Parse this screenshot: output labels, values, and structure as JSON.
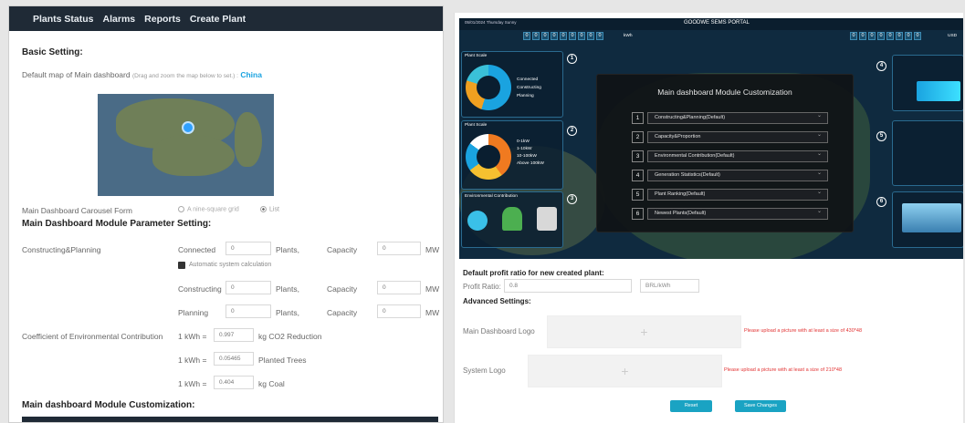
{
  "nav": {
    "items": [
      "Plants Status",
      "Alarms",
      "Reports",
      "Create Plant"
    ]
  },
  "left": {
    "basic_setting": "Basic Setting:",
    "default_map": "Default map of Main dashboard",
    "default_map_hint": "(Drag and zoom the map below to set.) :",
    "default_map_value": "China",
    "carousel_label": "Main Dashboard Carousel Form",
    "carousel_opt1": "A nine-square grid",
    "carousel_opt2": "List",
    "module_param": "Main Dashboard Module Parameter Setting:",
    "constructing_planning": "Constructing&Planning",
    "connected": "Connected",
    "constructing": "Constructing",
    "planning": "Planning",
    "plants": "Plants,",
    "capacity": "Capacity",
    "mw": "MW",
    "zero": "0",
    "auto_calc": "Automatic system calculation",
    "coef_label": "Coefficient of Environmental Contribution",
    "kwh": "1 kWh =",
    "co2_value": "0.997",
    "co2_unit": "kg CO2 Reduction",
    "trees_value": "0.05465",
    "trees_unit": "Planted Trees",
    "coal_value": "0.404",
    "coal_unit": "kg Coal",
    "module_custom": "Main dashboard Module Customization:"
  },
  "dashboard": {
    "date": "05/01/2024   Thursday   Sunny",
    "portal": "GOODWE SEMS PORTAL",
    "usd": "USD",
    "kwh": "kWh",
    "plant_scale_1": "Plant Scale",
    "plant_scale_2": "Plant Scale",
    "env_contribution": "Environmental Contribution",
    "badges": [
      "1",
      "2",
      "3",
      "4",
      "5",
      "6"
    ],
    "modal": {
      "title": "Main dashboard Module Customization",
      "rows": [
        {
          "n": "1",
          "label": "Constructing&Planning(Default)"
        },
        {
          "n": "2",
          "label": "Capacity&Proportion"
        },
        {
          "n": "3",
          "label": "Environmental Contribution(Default)"
        },
        {
          "n": "4",
          "label": "Generation Statistics(Default)"
        },
        {
          "n": "5",
          "label": "Plant Ranking(Default)"
        },
        {
          "n": "6",
          "label": "Newest Plants(Default)"
        }
      ]
    },
    "legend1": [
      "Connected",
      "Constructing",
      "Planning"
    ],
    "legend2": [
      "0-1kW",
      "1-10kW",
      "10-100kW",
      "Above 100kW"
    ]
  },
  "right": {
    "profit_heading": "Default profit ratio for new created plant:",
    "profit_label": "Profit Ratio:",
    "profit_value": "0.8",
    "profit_unit": "BRL/kWh",
    "advanced": "Advanced Settings:",
    "logo_label": "Main Dashboard Logo",
    "logo_warn": "Please upload a picture with at least a size of 430*48",
    "syslogo_label": "System Logo",
    "syslogo_warn": "Please upload a picture with at least a size of 210*48",
    "reset": "Reset",
    "save": "Save Changes",
    "plus": "+"
  }
}
